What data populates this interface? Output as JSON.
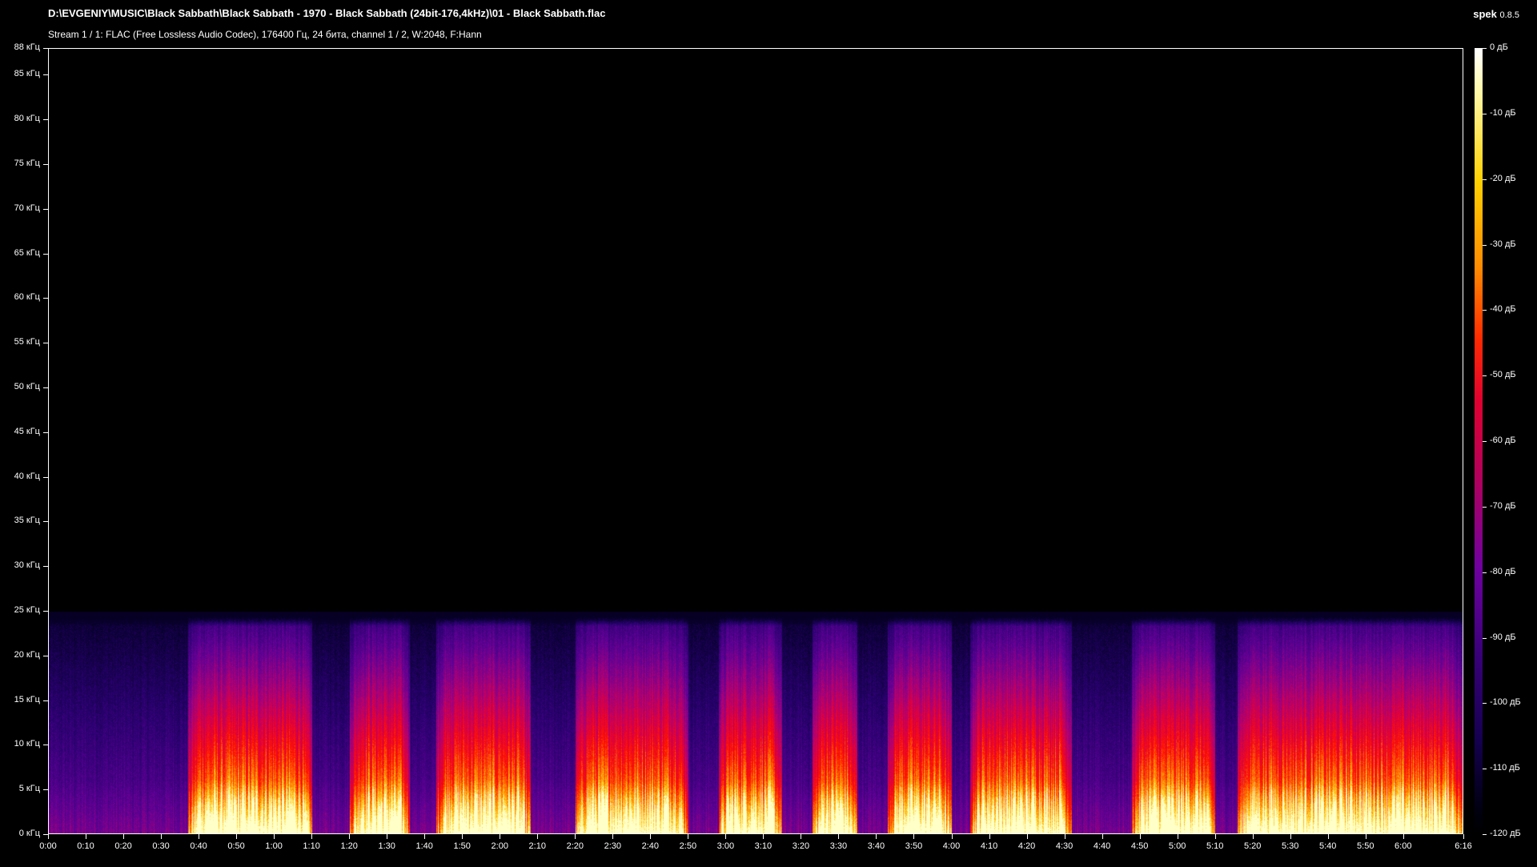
{
  "header": {
    "file_path": "D:\\EVGENIY\\MUSIC\\Black Sabbath\\Black Sabbath - 1970 - Black Sabbath (24bit-176,4kHz)\\01 - Black Sabbath.flac",
    "stream_info": "Stream 1 / 1: FLAC (Free Lossless Audio Codec), 176400 Гц, 24 бита, channel 1 / 2, W:2048, F:Hann",
    "app_name": "spek",
    "app_version": "0.8.5"
  },
  "colors": {
    "background": "#000000",
    "axis": "#ffffff",
    "text": "#ffffff"
  },
  "chart_data": {
    "type": "heatmap",
    "title": "D:\\EVGENIY\\MUSIC\\Black Sabbath\\Black Sabbath - 1970 - Black Sabbath (24bit-176,4kHz)\\01 - Black Sabbath.flac",
    "subtitle": "Stream 1 / 1: FLAC (Free Lossless Audio Codec), 176400 Гц, 24 бита, channel 1 / 2, W:2048, F:Hann",
    "x_unit": "time (m:ss)",
    "x_range_seconds": [
      0,
      376
    ],
    "y_unit": "кГц",
    "y_range_khz": [
      0,
      88
    ],
    "color_range_db": [
      -120,
      0
    ],
    "x_ticks": [
      "0:00",
      "0:10",
      "0:20",
      "0:30",
      "0:40",
      "0:50",
      "1:00",
      "1:10",
      "1:20",
      "1:30",
      "1:40",
      "1:50",
      "2:00",
      "2:10",
      "2:20",
      "2:30",
      "2:40",
      "2:50",
      "3:00",
      "3:10",
      "3:20",
      "3:30",
      "3:40",
      "3:50",
      "4:00",
      "4:10",
      "4:20",
      "4:30",
      "4:40",
      "4:50",
      "5:00",
      "5:10",
      "5:20",
      "5:30",
      "5:40",
      "5:50",
      "6:00",
      "6:16"
    ],
    "y_ticks": [
      "0 кГц",
      "5 кГц",
      "10 кГц",
      "15 кГц",
      "20 кГц",
      "25 кГц",
      "30 кГц",
      "35 кГц",
      "40 кГц",
      "45 кГц",
      "50 кГц",
      "55 кГц",
      "60 кГц",
      "65 кГц",
      "70 кГц",
      "75 кГц",
      "80 кГц",
      "85 кГц",
      "88 кГц"
    ],
    "db_ticks": [
      "0 дБ",
      "-10 дБ",
      "-20 дБ",
      "-30 дБ",
      "-40 дБ",
      "-50 дБ",
      "-60 дБ",
      "-70 дБ",
      "-80 дБ",
      "-90 дБ",
      "-100 дБ",
      "-110 дБ",
      "-120 дБ"
    ],
    "content_cutoff_khz": 24,
    "loud_sections_seconds": [
      [
        37,
        70
      ],
      [
        80,
        96
      ],
      [
        103,
        128
      ],
      [
        140,
        170
      ],
      [
        178,
        195
      ],
      [
        203,
        215
      ],
      [
        223,
        240
      ],
      [
        245,
        272
      ],
      [
        288,
        310
      ],
      [
        316,
        376
      ]
    ],
    "quiet_sections_seconds": [
      [
        0,
        37
      ],
      [
        70,
        80
      ],
      [
        96,
        103
      ],
      [
        128,
        140
      ],
      [
        170,
        178
      ],
      [
        195,
        203
      ],
      [
        215,
        223
      ],
      [
        240,
        245
      ],
      [
        272,
        288
      ],
      [
        310,
        316
      ]
    ]
  }
}
